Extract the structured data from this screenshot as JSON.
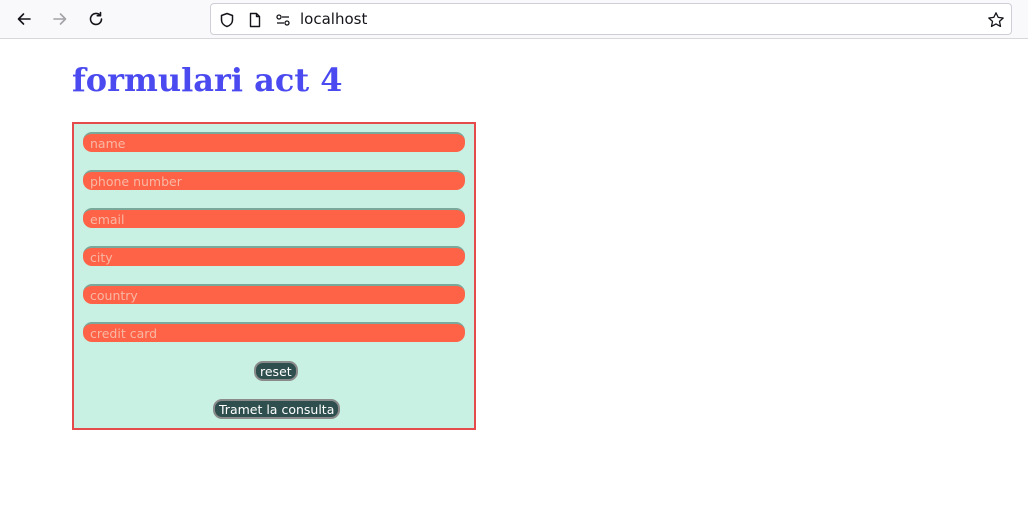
{
  "browser": {
    "url": "localhost",
    "back_icon": "arrow-left-icon",
    "forward_icon": "arrow-right-icon",
    "reload_icon": "reload-icon",
    "shield_icon": "shield-icon",
    "page_icon": "page-icon",
    "permissions_icon": "permissions-icon",
    "bookmark_icon": "star-icon"
  },
  "page": {
    "title": "formulari act 4"
  },
  "form": {
    "fields": [
      {
        "placeholder": "name"
      },
      {
        "placeholder": "phone number"
      },
      {
        "placeholder": "email"
      },
      {
        "placeholder": "city"
      },
      {
        "placeholder": "country"
      },
      {
        "placeholder": "credit card"
      }
    ],
    "reset_label": "reset",
    "submit_label": "Tramet la consulta"
  },
  "colors": {
    "title": "#4a4af0",
    "form_border": "#e54b4b",
    "form_background": "#c8f0e3",
    "field_background": "#ff6347",
    "button_background": "#2f4f4f"
  }
}
